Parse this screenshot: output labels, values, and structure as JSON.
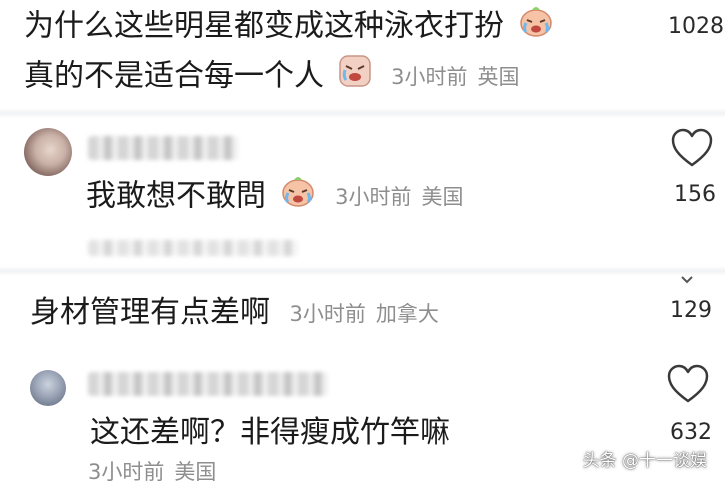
{
  "comments": [
    {
      "line1": "为什么这些明星都变成这种泳衣打扮",
      "line2": "真的不是适合每一个人",
      "time": "3小时前",
      "location": "英国",
      "likes": "1028"
    },
    {
      "text": "我敢想不敢問",
      "time": "3小时前",
      "location": "美国",
      "likes": "156"
    },
    {
      "text": "身材管理有点差啊",
      "time": "3小时前",
      "location": "加拿大",
      "likes": "129"
    },
    {
      "text": "这还差啊？非得瘦成竹竿嘛",
      "time": "3小时前",
      "location": "美国",
      "likes": "632"
    }
  ],
  "watermark": "头条 @十一谈娱",
  "colors": {
    "text": "#1b1b1b",
    "meta": "#8e8e8e",
    "heart": "#3a3a3a"
  },
  "icons": [
    "crying-emoji-icon",
    "heart-icon",
    "chevron-down-icon"
  ]
}
